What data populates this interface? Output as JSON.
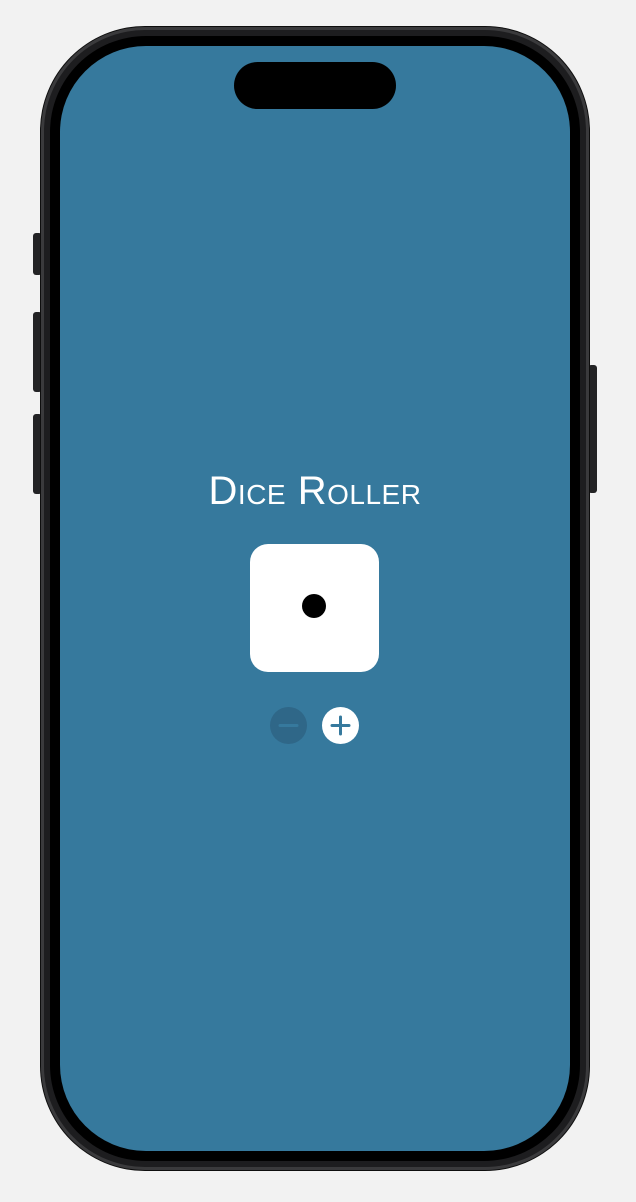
{
  "app": {
    "title": "Dice Roller"
  },
  "die": {
    "count": 1,
    "face_value": 1
  },
  "controls": {
    "decrease_icon": "minus-circle-icon",
    "decrease_enabled": false,
    "increase_icon": "plus-circle-icon",
    "increase_enabled": true
  },
  "colors": {
    "background": "#36799d",
    "die": "#ffffff",
    "pip": "#000000",
    "disabled_button": "#2f6788",
    "enabled_button": "#ffffff"
  }
}
